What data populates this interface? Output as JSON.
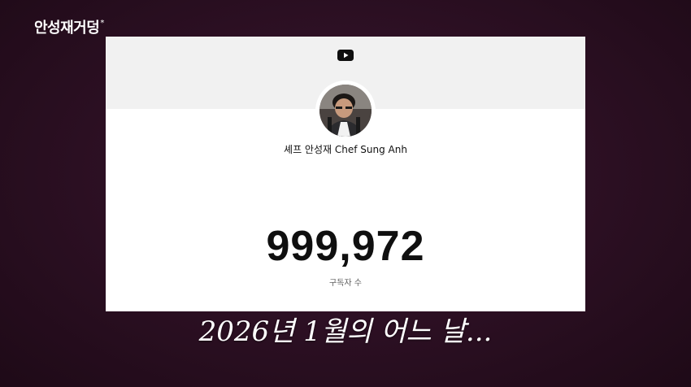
{
  "overlay": {
    "channel_logo": "안성재거덩",
    "channel_logo_mark": "*",
    "caption": "2026년 1월의 어느 날..."
  },
  "card": {
    "platform_icon": "youtube-play-icon",
    "channel_name": "셰프 안성재 Chef Sung Anh",
    "subscriber_count": "999,972",
    "subscriber_label": "구독자 수"
  },
  "colors": {
    "background": "#2b0f22",
    "card": "#ffffff",
    "banner": "#f1f1f1",
    "count_text": "#0f0f0f",
    "label_text": "#606060"
  }
}
